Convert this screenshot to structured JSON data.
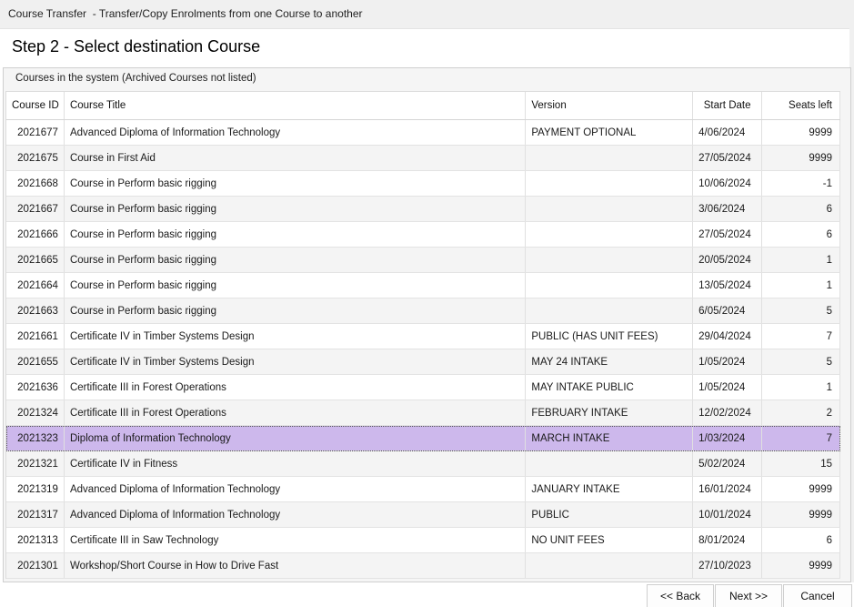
{
  "window": {
    "title": "Course Transfer  - Transfer/Copy Enrolments from one Course to another"
  },
  "step_heading": "Step 2 - Select destination Course",
  "group": {
    "caption": "Courses in the system (Archived Courses not listed)"
  },
  "table": {
    "columns": [
      "Course ID",
      "Course Title",
      "Version",
      "Start Date",
      "Seats left"
    ],
    "selected_index": 12,
    "rows": [
      {
        "id": "2021677",
        "title": "Advanced Diploma of Information Technology",
        "version": "PAYMENT OPTIONAL",
        "start": "4/06/2024",
        "seats": "9999"
      },
      {
        "id": "2021675",
        "title": "Course in First Aid",
        "version": "",
        "start": "27/05/2024",
        "seats": "9999"
      },
      {
        "id": "2021668",
        "title": "Course in Perform basic rigging",
        "version": "",
        "start": "10/06/2024",
        "seats": "-1"
      },
      {
        "id": "2021667",
        "title": "Course in Perform basic rigging",
        "version": "",
        "start": "3/06/2024",
        "seats": "6"
      },
      {
        "id": "2021666",
        "title": "Course in Perform basic rigging",
        "version": "",
        "start": "27/05/2024",
        "seats": "6"
      },
      {
        "id": "2021665",
        "title": "Course in Perform basic rigging",
        "version": "",
        "start": "20/05/2024",
        "seats": "1"
      },
      {
        "id": "2021664",
        "title": "Course in Perform basic rigging",
        "version": "",
        "start": "13/05/2024",
        "seats": "1"
      },
      {
        "id": "2021663",
        "title": "Course in Perform basic rigging",
        "version": "",
        "start": "6/05/2024",
        "seats": "5"
      },
      {
        "id": "2021661",
        "title": "Certificate IV in Timber Systems Design",
        "version": "PUBLIC (HAS UNIT FEES)",
        "start": "29/04/2024",
        "seats": "7"
      },
      {
        "id": "2021655",
        "title": "Certificate IV in Timber Systems Design",
        "version": "MAY 24 INTAKE",
        "start": "1/05/2024",
        "seats": "5"
      },
      {
        "id": "2021636",
        "title": "Certificate III in Forest Operations",
        "version": "MAY INTAKE PUBLIC",
        "start": "1/05/2024",
        "seats": "1"
      },
      {
        "id": "2021324",
        "title": "Certificate III in Forest Operations",
        "version": "FEBRUARY INTAKE",
        "start": "12/02/2024",
        "seats": "2"
      },
      {
        "id": "2021323",
        "title": "Diploma of Information Technology",
        "version": "MARCH INTAKE",
        "start": "1/03/2024",
        "seats": "7"
      },
      {
        "id": "2021321",
        "title": "Certificate IV in Fitness",
        "version": "",
        "start": "5/02/2024",
        "seats": "15"
      },
      {
        "id": "2021319",
        "title": "Advanced Diploma of Information Technology",
        "version": "JANUARY INTAKE",
        "start": "16/01/2024",
        "seats": "9999"
      },
      {
        "id": "2021317",
        "title": "Advanced Diploma of Information Technology",
        "version": "PUBLIC",
        "start": "10/01/2024",
        "seats": "9999"
      },
      {
        "id": "2021313",
        "title": "Certificate III in Saw Technology",
        "version": "NO UNIT FEES",
        "start": "8/01/2024",
        "seats": "6"
      },
      {
        "id": "2021301",
        "title": "Workshop/Short Course in How to Drive Fast",
        "version": "",
        "start": "27/10/2023",
        "seats": "9999"
      }
    ]
  },
  "buttons": {
    "back": "<< Back",
    "next": "Next >>",
    "cancel": "Cancel"
  },
  "colors": {
    "selected_row": "#cdb8ec",
    "alt_row": "#f4f4f4"
  }
}
